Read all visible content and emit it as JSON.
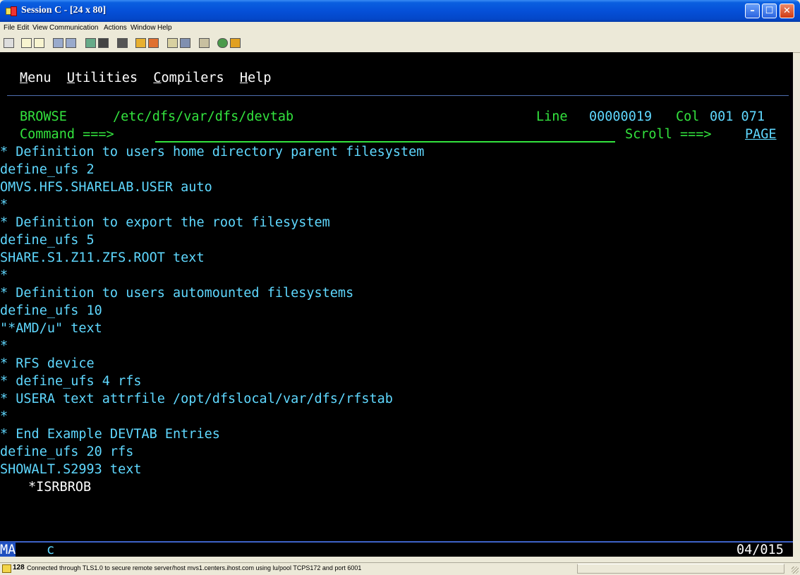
{
  "window": {
    "title": "Session C - [24 x 80]"
  },
  "menubar": [
    "File",
    "Edit",
    "View",
    "Communication",
    "Actions",
    "Window",
    "Help"
  ],
  "toolbar_icons": [
    "display-icon",
    "copy-icon",
    "paste-icon",
    "send-file-icon",
    "receive-file-icon",
    "macro-record-icon",
    "macro-play-icon",
    "print-screen-icon",
    "keypad-icon",
    "transfer-up-icon",
    "transfer-down-icon",
    "connect-icon",
    "disconnect-icon",
    "clipboard-icon",
    "globe-icon",
    "pencil-icon"
  ],
  "terminal": {
    "action_bar": {
      "menu": "Menu",
      "utilities": "Utilities",
      "compilers": "Compilers",
      "help": "Help"
    },
    "header": {
      "mode": "BROWSE",
      "path": "/etc/dfs/var/dfs/devtab",
      "line_label": "Line",
      "line_value": "00000019",
      "col_label": "Col",
      "col_value": "001 071",
      "command_label": "Command ===>",
      "scroll_label": "Scroll ===>",
      "scroll_value": "PAGE"
    },
    "lines": [
      "* Definition to users home directory parent filesystem",
      "define_ufs 2",
      "OMVS.HFS.SHARELAB.USER auto",
      "*",
      "* Definition to export the root filesystem",
      "define_ufs 5",
      "SHARE.S1.Z11.ZFS.ROOT text",
      "*",
      "* Definition to users automounted filesystems",
      "define_ufs 10",
      "\"*AMD/u\" text",
      "*",
      "* RFS device",
      "* define_ufs 4 rfs",
      "* USERA text attrfile /opt/dfslocal/var/dfs/rfstab",
      "*",
      "* End Example DEVTAB Entries",
      "define_ufs 20 rfs",
      "SHOWALT.S2993 text"
    ],
    "message_line": "*ISRBROB",
    "oia": {
      "ma": "MA",
      "session": "c",
      "cursor_pos": "04/015"
    }
  },
  "statusbar": {
    "code": "128",
    "text": "Connected through TLS1.0 to secure remote server/host mvs1.centers.ihost.com using lu/pool TCPS172 and port 6001"
  },
  "colors": {
    "title_bar": "#0550d8",
    "terminal_bg": "#000000",
    "cyan": "#5fd8ff",
    "green": "#33e33e",
    "white": "#ffffff"
  }
}
